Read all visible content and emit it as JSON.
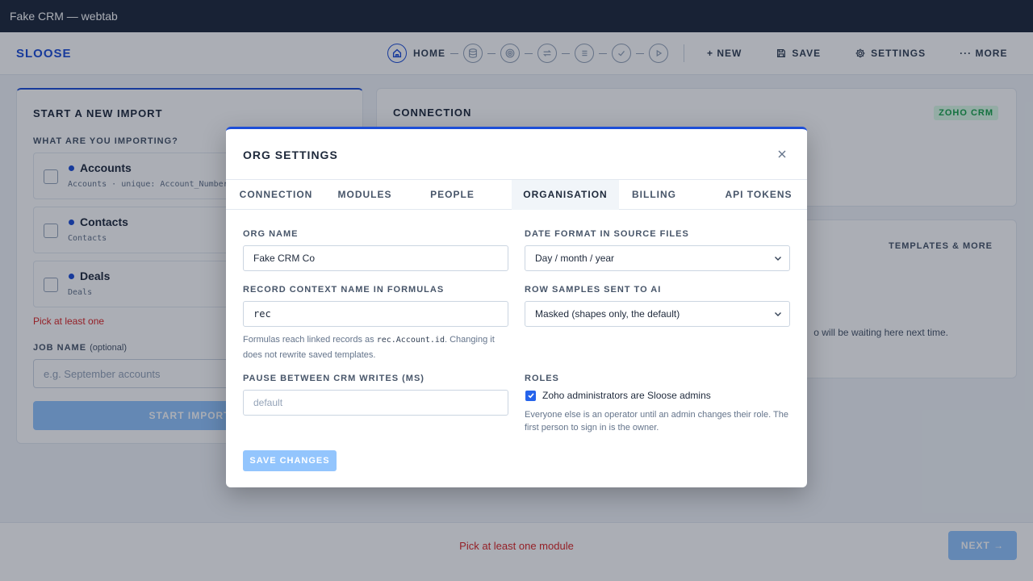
{
  "window": {
    "title": "Fake CRM — webtab"
  },
  "header": {
    "brand": "SLOOSE",
    "home_label": "HOME",
    "actions": {
      "new": "+ NEW",
      "save": "SAVE",
      "settings": "SETTINGS",
      "more": "··· MORE"
    }
  },
  "import_card": {
    "title": "START A NEW IMPORT",
    "question": "WHAT ARE YOU IMPORTING?",
    "modules": [
      {
        "name": "Accounts",
        "meta": "Accounts · unique: Account_Number"
      },
      {
        "name": "Contacts",
        "meta": "Contacts"
      },
      {
        "name": "Deals",
        "meta": "Deals"
      }
    ],
    "error": "Pick at least one",
    "job_label": "JOB NAME",
    "job_optional": "(optional)",
    "job_placeholder": "e.g. September accounts",
    "start_button": "START IMPORT"
  },
  "connection_card": {
    "title": "CONNECTION",
    "badge": "ZOHO CRM"
  },
  "templates_card": {
    "label": "TEMPLATES & MORE",
    "hint": "o will be waiting here next time."
  },
  "footer": {
    "message": "Pick at least one module",
    "next_button": "NEXT →"
  },
  "modal": {
    "title": "ORG SETTINGS",
    "tabs": [
      "CONNECTION",
      "MODULES",
      "PEOPLE",
      "ORGANISATION",
      "BILLING",
      "API TOKENS"
    ],
    "active_tab": "ORGANISATION",
    "org_name": {
      "label": "ORG NAME",
      "value": "Fake CRM Co"
    },
    "date_format": {
      "label": "DATE FORMAT IN SOURCE FILES",
      "value": "Day / month / year"
    },
    "record_context": {
      "label": "RECORD CONTEXT NAME IN FORMULAS",
      "value": "rec",
      "hint_before": "Formulas reach linked records as ",
      "hint_code": "rec.Account.id",
      "hint_after": ". Changing it does not rewrite saved templates."
    },
    "row_samples": {
      "label": "ROW SAMPLES SENT TO AI",
      "value": "Masked (shapes only, the default)"
    },
    "pause": {
      "label": "PAUSE BETWEEN CRM WRITES (MS)",
      "placeholder": "default"
    },
    "roles": {
      "label": "ROLES",
      "checkbox_label": "Zoho administrators are Sloose admins",
      "checked": true,
      "hint": "Everyone else is an operator until an admin changes their role. The first person to sign in is the owner."
    },
    "save_button": "SAVE CHANGES"
  },
  "colors": {
    "accent": "#1d4ed8",
    "error": "#dc2626",
    "disabled_button": "#93c5fd",
    "success": "#16a34a"
  }
}
